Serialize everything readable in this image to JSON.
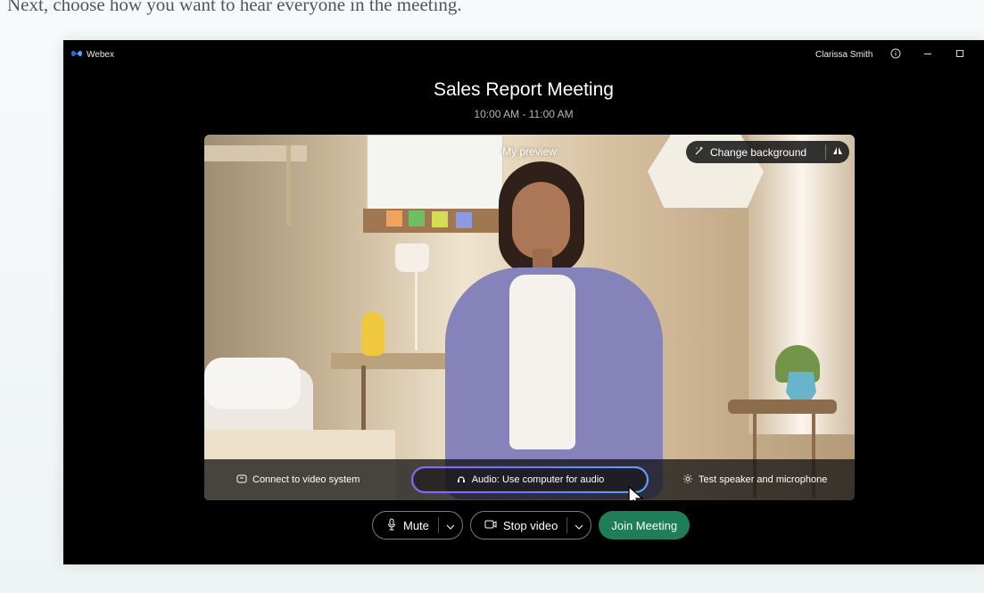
{
  "caption": "Next, choose how you want to hear everyone in the meeting.",
  "window": {
    "app_name": "Webex",
    "user_name": "Clarissa Smith",
    "meeting_title": "Sales Report Meeting",
    "meeting_time": "10:00 AM - 11:00 AM"
  },
  "preview": {
    "label": "My preview",
    "change_background": "Change background",
    "connect_video": "Connect to video system",
    "audio_option": "Audio: Use computer for audio",
    "test_speaker": "Test speaker and microphone"
  },
  "controls": {
    "mute": "Mute",
    "stop_video": "Stop video",
    "join_meeting": "Join Meeting"
  },
  "colors": {
    "accent_join": "#1f7d58",
    "audio_outline": "#6f72ff"
  },
  "icons": {
    "logo": "webex-logo-icon",
    "info": "info-icon",
    "minimize": "minimize-icon",
    "maximize": "maximize-icon",
    "close": "close-icon"
  }
}
